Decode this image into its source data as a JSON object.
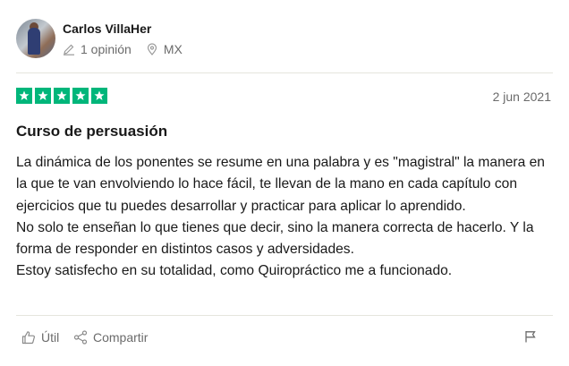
{
  "reviewer": {
    "name": "Carlos VillaHer",
    "reviews_count": "1 opinión",
    "country": "MX",
    "avatar_icon": "user-avatar-photo"
  },
  "review": {
    "rating": 5,
    "rating_max": 5,
    "star_color": "#00b67a",
    "date": "2 jun 2021",
    "title": "Curso de persuasión",
    "paragraphs": [
      "La dinámica de los ponentes se resume en una palabra y es \"magistral\" la manera en la que te van envolviendo lo hace fácil, te llevan de la mano en cada capítulo con ejercicios que tu puedes desarrollar y practicar para aplicar lo aprendido.",
      "No solo te enseñan lo que tienes que decir, sino la manera correcta de hacerlo. Y la forma de responder en distintos casos y adversidades.",
      "Estoy satisfecho en su totalidad, como Quiropráctico me a funcionado."
    ]
  },
  "actions": {
    "useful_label": "Útil",
    "share_label": "Compartir",
    "useful_icon": "thumbs-up-icon",
    "share_icon": "share-icon",
    "report_icon": "flag-icon"
  }
}
